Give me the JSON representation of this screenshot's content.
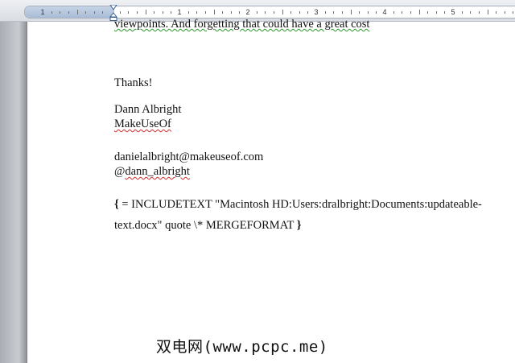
{
  "ruler": {
    "numbers": [
      "1",
      "1",
      "2",
      "3",
      "4",
      "5"
    ]
  },
  "document": {
    "partial_line": "viewpoints. And forgetting that could have a great cost",
    "thanks": "Thanks!",
    "signature_name": "Dann Albright",
    "signature_company": "MakeUseOf",
    "email": "danielalbright@makeuseof.com",
    "handle_prefix": "@",
    "handle": "dann_albright",
    "field_open_brace": "{",
    "field_line1": " = INCLUDETEXT \"Macintosh HD:Users:dralbright:Documents:updateable-",
    "field_line2": "text.docx\" quote \\* MERGEFORMAT ",
    "field_close_brace": "}"
  },
  "watermark": "双电网(www.pcpc.me)",
  "colors": {
    "ruler_margin": "#b6c6de",
    "grammar_underline": "#2a9a2a",
    "spelling_underline": "#d12a2a",
    "gutter": "#b9bdc2"
  }
}
